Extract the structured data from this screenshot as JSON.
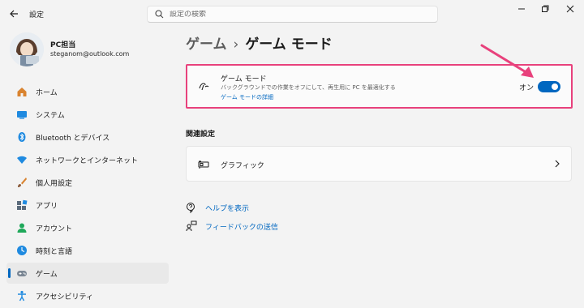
{
  "app": {
    "title": "設定"
  },
  "search": {
    "placeholder": "設定の検索"
  },
  "profile": {
    "name": "PC担当",
    "email": "steganom@outlook.com"
  },
  "nav": {
    "items": [
      {
        "label": "ホーム",
        "icon": "home-icon"
      },
      {
        "label": "システム",
        "icon": "system-icon"
      },
      {
        "label": "Bluetooth とデバイス",
        "icon": "bluetooth-icon"
      },
      {
        "label": "ネットワークとインターネット",
        "icon": "wifi-icon"
      },
      {
        "label": "個人用設定",
        "icon": "brush-icon"
      },
      {
        "label": "アプリ",
        "icon": "apps-icon"
      },
      {
        "label": "アカウント",
        "icon": "account-icon"
      },
      {
        "label": "時刻と言語",
        "icon": "time-language-icon"
      },
      {
        "label": "ゲーム",
        "icon": "gamepad-icon",
        "active": true
      },
      {
        "label": "アクセシビリティ",
        "icon": "accessibility-icon"
      }
    ]
  },
  "breadcrumb": {
    "parent": "ゲーム",
    "separator": "›",
    "current": "ゲーム モード"
  },
  "game_mode": {
    "title": "ゲーム モード",
    "description": "バックグラウンドでの作業をオフにして、再生用に PC を最適化する",
    "link": "ゲーム モードの詳細",
    "toggle_label": "オン",
    "toggle_on": true
  },
  "related": {
    "title": "関連設定",
    "graphics_label": "グラフィック"
  },
  "help": {
    "get_help": "ヘルプを表示",
    "feedback": "フィードバックの送信"
  },
  "colors": {
    "accent": "#0067c0",
    "highlight": "#e8417c"
  }
}
